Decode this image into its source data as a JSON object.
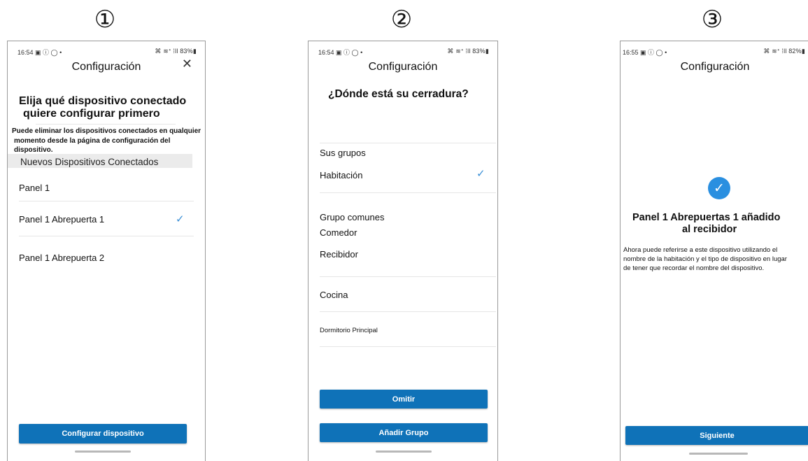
{
  "steps": [
    "①",
    "②",
    "③"
  ],
  "screen1": {
    "status_left": "16:54 ▣ ⓘ ◯ •",
    "status_right": "⌘ ≋ᐩ ⁞ll 83%▮",
    "title": "Configuración",
    "close": "✕",
    "heading_line1": "Elija qué dispositivo conectado",
    "heading_line2": "quiere configurar primero",
    "desc_line1": "Puede eliminar los dispositivos conectados en qualquier",
    "desc_line2": "momento desde la página de configuración del dispositivo.",
    "section": "Nuevos Dispositivos Conectados",
    "items": [
      "Panel 1",
      "Panel 1 Abrepuerta 1",
      "Panel 1 Abrepuerta 2"
    ],
    "check": "✓",
    "button": "Configurar dispositivo"
  },
  "screen2": {
    "status_left": "16:54 ▣ ⓘ ◯ •",
    "status_right": "⌘ ≋ᐩ ⁞ll 83%▮",
    "title": "Configuración",
    "heading": "¿Dónde está su cerradura?",
    "your_groups": "Sus grupos",
    "group_selected": "Habitación",
    "check": "✓",
    "common_groups": "Grupo comunes",
    "common_items": [
      "Comedor",
      "Recibidor",
      "Cocina",
      "Dormitorio Principal"
    ],
    "skip_button": "Omitir",
    "add_button": "Añadir Grupo"
  },
  "screen3": {
    "status_left": "16:55 ▣ ⓘ ◯ •",
    "status_right": "⌘ ≋ᐩ ⁞ll 82%▮",
    "title": "Configuración",
    "check": "✓",
    "heading_line1": "Panel 1 Abrepuertas 1 añadido",
    "heading_line2": "al recibidor",
    "desc_line1": "Ahora puede referirse a este dispositivo utilizando el",
    "desc_line2": "nombre de la habitación y el tipo de dispositivo en lugar",
    "desc_line3": "de tener que recordar el nombre del dispositivo.",
    "button": "Siguiente"
  },
  "colors": {
    "primary": "#0f72b8",
    "check": "#3a8fd6",
    "section_bg": "#ebebeb"
  }
}
